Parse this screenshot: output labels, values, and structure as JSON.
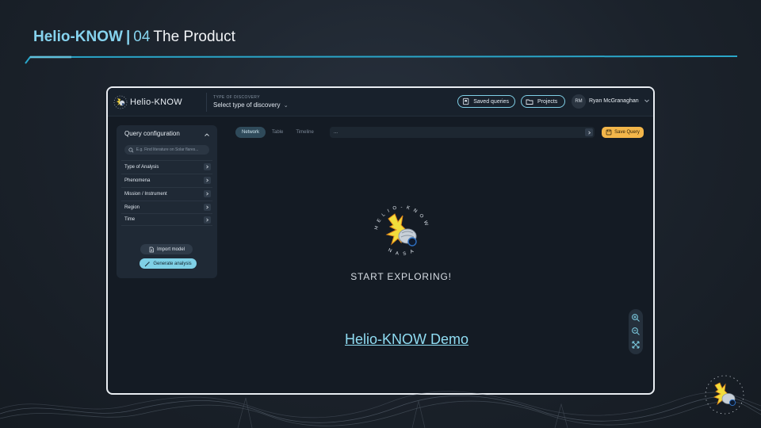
{
  "slide": {
    "brand": "Helio-KNOW",
    "separator": "|",
    "section_number": "04",
    "section_title": "The Product"
  },
  "app": {
    "name": "Helio-KNOW",
    "discovery_label": "TYPE OF DISCOVERY",
    "discovery_select": "Select type of discovery",
    "saved_queries": "Saved queries",
    "projects": "Projects",
    "user_initials": "RM",
    "user_name": "Ryan McGranaghan"
  },
  "sidebar": {
    "title": "Query configuration",
    "search_placeholder": "E.g. Find literature on Solar flares...",
    "items": [
      {
        "label": "Type of Analysis"
      },
      {
        "label": "Phenomena"
      },
      {
        "label": "Mission / Instrument"
      },
      {
        "label": "Region"
      },
      {
        "label": "Time"
      }
    ],
    "import_label": "Import model",
    "generate_label": "Generate analysis"
  },
  "main": {
    "tabs": [
      {
        "label": "Network",
        "active": true
      },
      {
        "label": "Table",
        "active": false
      },
      {
        "label": "Timeline",
        "active": false
      }
    ],
    "query_text": "...",
    "save_query": "Save Query",
    "emblem_ring_top": "HELIO-KNOW",
    "emblem_ring_bottom": "NASA",
    "start_text": "START EXPLORING!",
    "demo_link": "Helio-KNOW Demo"
  },
  "icons": {
    "saved": "bookmark-icon",
    "projects": "folder-icon",
    "search": "search-icon",
    "arrow": "chevron-right-icon",
    "zoom_in": "zoom-in-icon",
    "zoom_out": "zoom-out-icon",
    "fit": "fit-screen-icon"
  },
  "colors": {
    "accent": "#7fd0e6",
    "save_query": "#f3b64a",
    "frame_border": "#e9edf2",
    "background": "#1b222b"
  }
}
